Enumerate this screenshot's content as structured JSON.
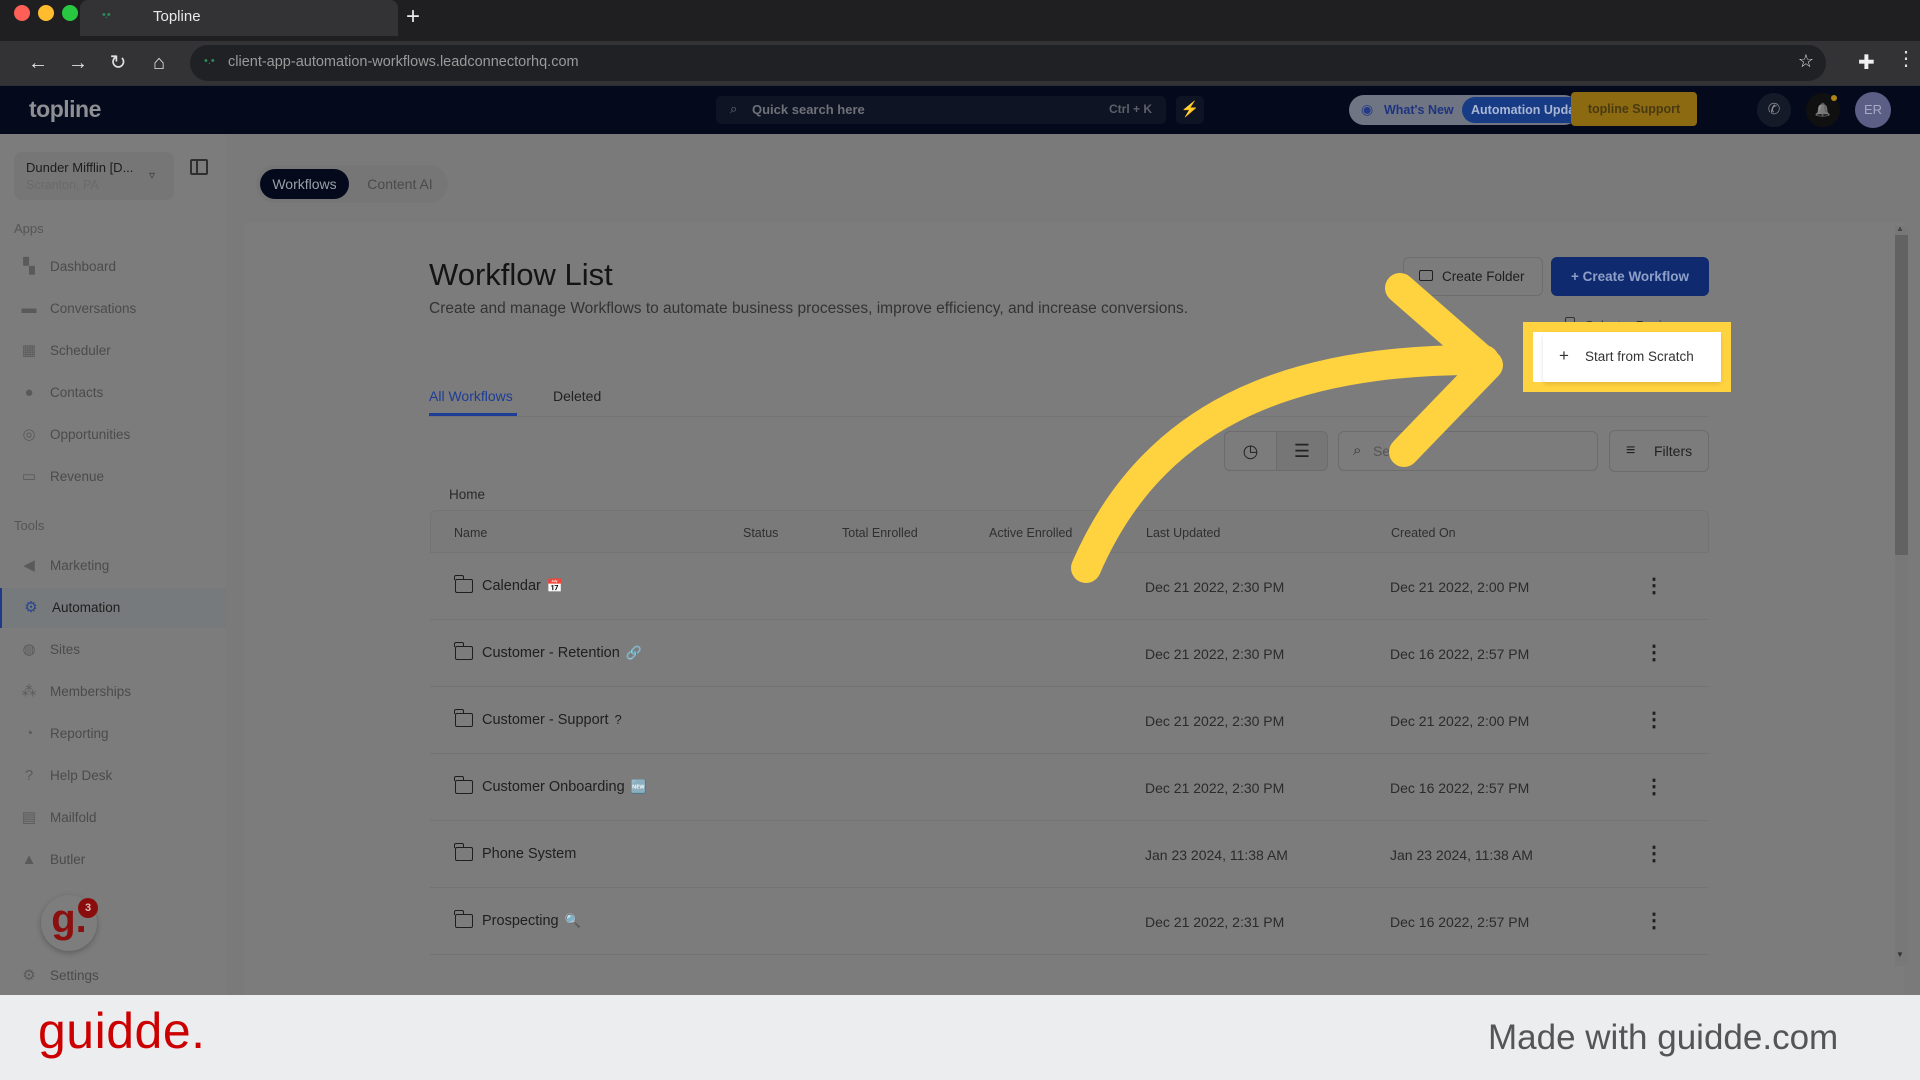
{
  "browser": {
    "tab_title": "Topline",
    "new_tab": "+",
    "url": "client-app-automation-workflows.leadconnectorhq.com",
    "nav": {
      "back": "←",
      "forward": "→",
      "reload": "↻",
      "home": "⌂",
      "bookmark": "☆",
      "extensions": "✚",
      "menu": "⋮"
    }
  },
  "header": {
    "logo": "topline",
    "search_placeholder": "Quick search here",
    "search_shortcut": "Ctrl + K",
    "bolt": "⚡",
    "whats_new": "What's New",
    "automation_updates": "Automation Updates",
    "support": "topline Support",
    "phone": "✆",
    "bell": "🔔",
    "avatar_initials": "ER"
  },
  "sidebar": {
    "account_name": "Dunder Mifflin [D...",
    "account_location": "Scranton, PA",
    "apps_label": "Apps",
    "tools_label": "Tools",
    "apps": [
      {
        "label": "Dashboard",
        "icon": "▚"
      },
      {
        "label": "Conversations",
        "icon": "▬"
      },
      {
        "label": "Scheduler",
        "icon": "▦"
      },
      {
        "label": "Contacts",
        "icon": "●"
      },
      {
        "label": "Opportunities",
        "icon": "◎"
      },
      {
        "label": "Revenue",
        "icon": "▭"
      }
    ],
    "tools": [
      {
        "label": "Marketing",
        "icon": "◀"
      },
      {
        "label": "Automation",
        "icon": "⚙",
        "active": true
      },
      {
        "label": "Sites",
        "icon": "◍"
      },
      {
        "label": "Memberships",
        "icon": "⁂"
      },
      {
        "label": "Reporting",
        "icon": "◔"
      },
      {
        "label": "Help Desk",
        "icon": "?"
      },
      {
        "label": "Mailfold",
        "icon": "▤"
      },
      {
        "label": "Butler",
        "icon": "▲"
      }
    ],
    "guidde_widget": "g.",
    "guidde_badge": "3",
    "settings": "Settings",
    "settings_icon": "⚙"
  },
  "main": {
    "top_tabs": [
      "Workflows",
      "Content AI"
    ],
    "title": "Workflow List",
    "subtitle": "Create and manage Workflows to automate business processes, improve efficiency, and increase conversions.",
    "create_folder": "Create Folder",
    "create_workflow": "+  Create Workflow",
    "dropdown": {
      "select_recipe": "Select a Recipe",
      "start_from_scratch": "Start from Scratch",
      "plus": "+"
    },
    "list_tabs": [
      "All Workflows",
      "Deleted"
    ],
    "search_placeholder": "Search",
    "search_icon": "⌕",
    "filters": "Filters",
    "filters_icon": "≡",
    "clock_icon": "◷",
    "list_icon": "☰",
    "breadcrumb": "Home",
    "table": {
      "columns": [
        "Name",
        "Status",
        "Total Enrolled",
        "Active Enrolled",
        "Last Updated",
        "Created On"
      ],
      "rows": [
        {
          "name": "Calendar",
          "emoji": "📅",
          "last_updated": "Dec 21 2022, 2:30 PM",
          "created_on": "Dec 21 2022, 2:00 PM"
        },
        {
          "name": "Customer - Retention",
          "emoji": "🔗",
          "last_updated": "Dec 21 2022, 2:30 PM",
          "created_on": "Dec 16 2022, 2:57 PM"
        },
        {
          "name": "Customer - Support",
          "emoji": "?",
          "last_updated": "Dec 21 2022, 2:30 PM",
          "created_on": "Dec 21 2022, 2:00 PM"
        },
        {
          "name": "Customer Onboarding",
          "emoji": "🆕",
          "last_updated": "Dec 21 2022, 2:30 PM",
          "created_on": "Dec 16 2022, 2:57 PM"
        },
        {
          "name": "Phone System",
          "emoji": "",
          "last_updated": "Jan 23 2024, 11:38 AM",
          "created_on": "Jan 23 2024, 11:38 AM"
        },
        {
          "name": "Prospecting",
          "emoji": "🔍",
          "last_updated": "Dec 21 2022, 2:31 PM",
          "created_on": "Dec 16 2022, 2:57 PM"
        }
      ],
      "row_menu": "⋮"
    }
  },
  "footer": {
    "logo": "guidde.",
    "made_with": "Made with guidde.com"
  },
  "colors": {
    "highlight": "#ffd23f",
    "brand_blue": "#0f2a6e",
    "guidde_red": "#cc0000"
  }
}
